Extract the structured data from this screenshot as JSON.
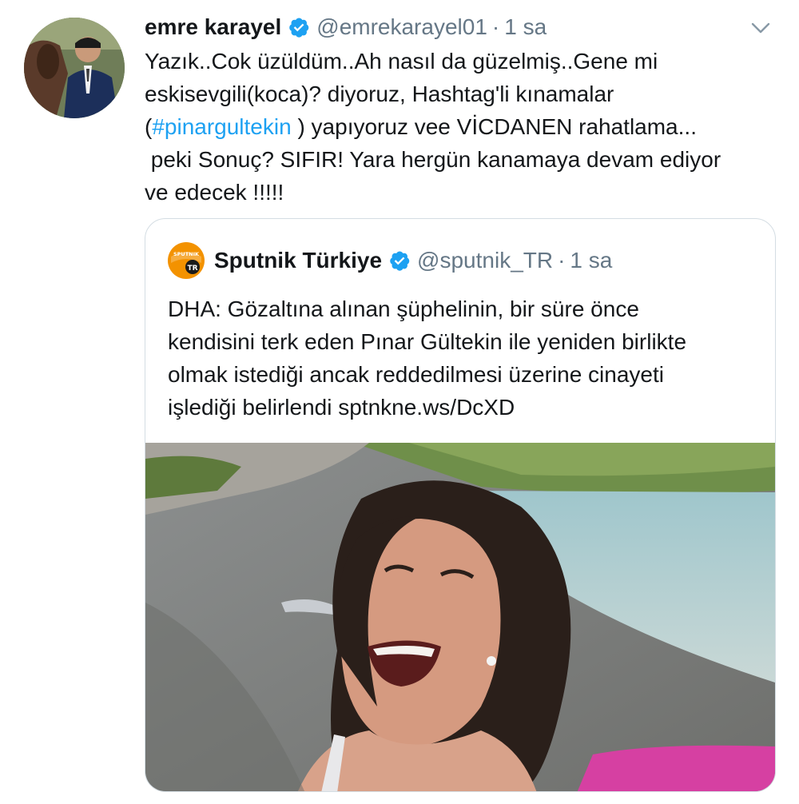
{
  "tweet": {
    "display_name": "emre karayel",
    "handle": "@emrekarayel01",
    "separator": "·",
    "time": "1 sa",
    "text_lines": [
      "Yazık..Cok üzüldüm..Ah nasıl da güzelmiş..Gene mi",
      "eskisevgili(koca)? diyoruz, Hashtag'li kınamalar",
      "(",
      "#pinargultekin",
      " ) yapıyoruz vee VİCDANEN rahatlama...",
      " peki Sonuç? SIFIR! Yara hergün kanamaya devam ediyor",
      "ve edecek !!!!!"
    ]
  },
  "quoted": {
    "display_name": "Sputnik Türkiye",
    "handle": "@sputnik_TR",
    "separator": "·",
    "time": "1 sa",
    "avatar_text_top": "SPUTNIK",
    "avatar_text_bottom": "TR",
    "text_lines": [
      "DHA: Gözaltına alınan şüphelinin, bir süre önce",
      "kendisini terk eden Pınar Gültekin ile yeniden birlikte",
      "olmak istediği ancak reddedilmesi üzerine cinayeti",
      "işlediği belirlendi sptnkne.ws/DcXD"
    ]
  },
  "colors": {
    "accent": "#1da1f2",
    "muted": "#657786",
    "border": "#d4dde3",
    "sputnik_orange": "#f39200"
  }
}
